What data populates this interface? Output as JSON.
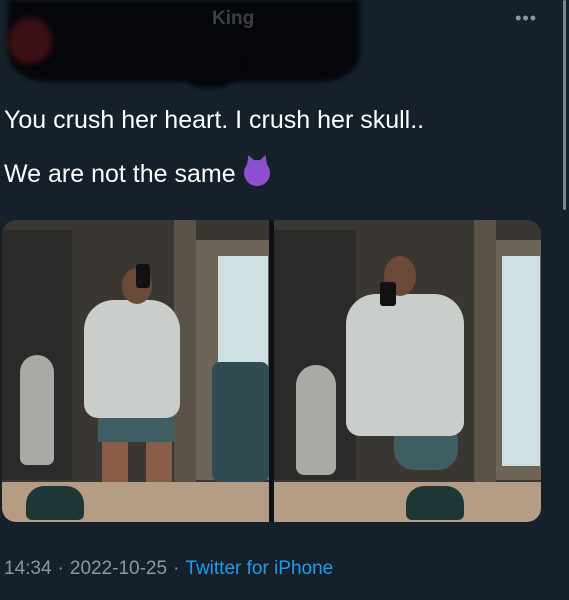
{
  "header": {
    "display_name": "King",
    "more_icon": "more-horizontal-icon"
  },
  "tweet": {
    "lines": [
      "You crush her heart. I crush her skull..",
      "We are not the same"
    ],
    "emoji": "smiling-imp-emoji"
  },
  "media": {
    "photos": [
      {
        "name": "mirror-selfie-front"
      },
      {
        "name": "mirror-selfie-side"
      }
    ]
  },
  "footer": {
    "time": "14:34",
    "separator": "·",
    "date": "2022-10-25",
    "source": "Twitter for iPhone"
  },
  "colors": {
    "background": "#15202b",
    "text": "#ffffff",
    "muted": "#8899a6",
    "link": "#1d9bf0"
  }
}
